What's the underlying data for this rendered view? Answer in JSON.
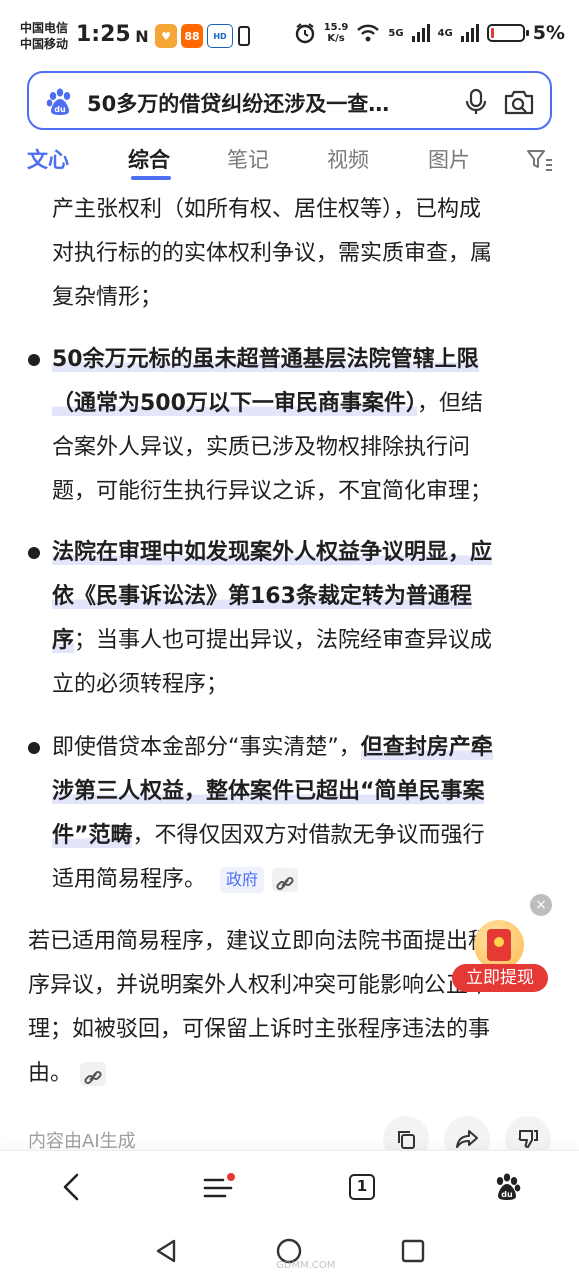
{
  "status_bar": {
    "carrier_1": "中国电信",
    "carrier_2": "中国移动",
    "time": "1:25",
    "speed_value": "15.9",
    "speed_unit": "K/s",
    "net_1": "5G",
    "net_2": "4G",
    "battery_percent": "5%",
    "battery_level": 0.05,
    "icons": [
      "nfc-icon",
      "heart-app-icon",
      "orange-app-icon",
      "hd-tag-icon",
      "battery-saver-icon",
      "alarm-icon",
      "wifi-icon",
      "signal-icon"
    ]
  },
  "search": {
    "query": "50多万的借贷纠纷还涉及一查…",
    "icons": [
      "baidu-paw-icon",
      "mic-icon",
      "camera-search-icon"
    ],
    "accent_color": "#4e6ef2"
  },
  "tabs": {
    "items": [
      "文心",
      "综合",
      "笔记",
      "视频",
      "图片"
    ],
    "active": "综合",
    "filter_icon": "filter-icon"
  },
  "article": {
    "intro_lines": [
      "产主张权利（如所有权、居住权等），已构成",
      "对执行标的的实体权利争议，需实质审查，属",
      "复杂情形；"
    ],
    "bullets": [
      {
        "hl_1": "50余万元标的虽未超普通基层法院管辖上限",
        "hl_2": "（通常为500万以下一审民商事案件）",
        "text_1": "，但结",
        "lines": [
          "合案外人异议，实质已涉及物权排除执行问",
          "题，可能衍生执行异议之诉，不宜简化审理；"
        ]
      },
      {
        "hl_1": "法院在审理中如发现案外人权益争议明显，应",
        "hl_2": "依《民事诉讼法》第163条裁定转为普通程",
        "hl_3": "序",
        "text_1": "；当事人也可提出异议，法院经审查异议成",
        "text_2": "立的必须转程序；"
      },
      {
        "text_1": "即使借贷本金部分“事实清楚”，",
        "hl_1": "但查封房产牵",
        "hl_2": "涉第三人权益，整体案件已超出“简单民事案",
        "hl_3": "件”范畴",
        "text_2": "，不得仅因双方对借款无争议而强行",
        "text_3": "适用简易程序。",
        "source_tag": "政府"
      }
    ],
    "conclusion_lines": [
      "若已适用简易程序，建议立即向法院书面提出程",
      "序异议，并说明案外人权利冲突可能影响公正审",
      "理；如被驳回，可保留上诉时主张程序违法的事",
      "由。"
    ]
  },
  "promo": {
    "label": "立即提现",
    "close": "×"
  },
  "ai_footer": {
    "note": "内容由AI生成",
    "actions": [
      "copy-icon",
      "share-icon",
      "dislike-icon"
    ]
  },
  "bottom_nav": {
    "tab_count": "1",
    "items": [
      "back-icon",
      "menu-icon",
      "tabs-icon",
      "baidu-paw-icon"
    ]
  },
  "watermark": {
    "text": "GDMM.COM"
  }
}
